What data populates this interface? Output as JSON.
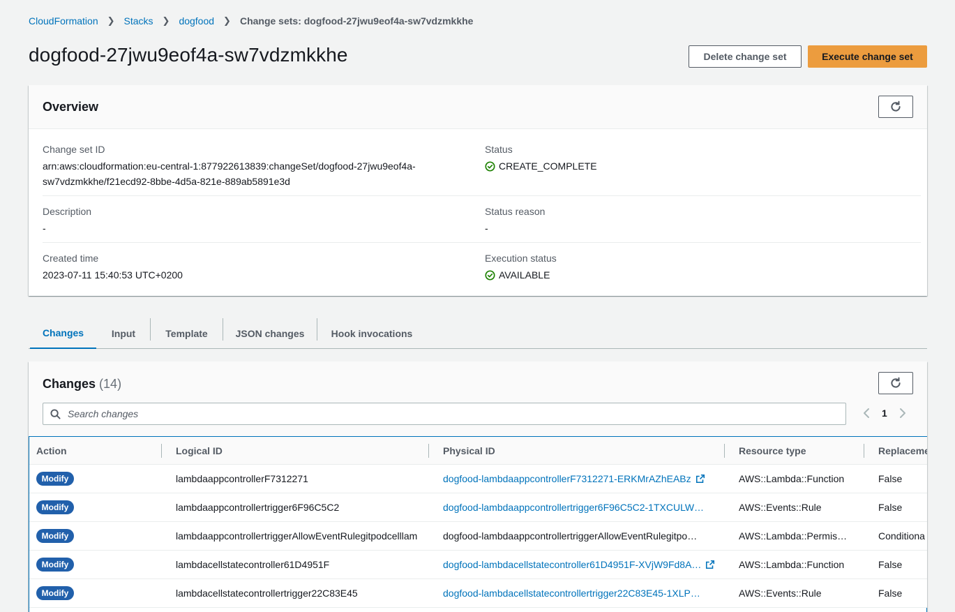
{
  "breadcrumb": {
    "items": [
      "CloudFormation",
      "Stacks",
      "dogfood"
    ],
    "current": "Change sets: dogfood-27jwu9eof4a-sw7vdzmkkhe"
  },
  "page": {
    "title": "dogfood-27jwu9eof4a-sw7vdzmkkhe",
    "delete_label": "Delete change set",
    "execute_label": "Execute change set"
  },
  "overview": {
    "title": "Overview",
    "changeset_id_label": "Change set ID",
    "changeset_id_line1": "arn:aws:cloudformation:eu-central-1:877922613839:changeSet/dogfood-27jwu9eof4a-",
    "changeset_id_line2": "sw7vdzmkkhe/f21ecd92-8bbe-4d5a-821e-889ab5891e3d",
    "status_label": "Status",
    "status_value": "CREATE_COMPLETE",
    "description_label": "Description",
    "description_value": "-",
    "status_reason_label": "Status reason",
    "status_reason_value": "-",
    "created_label": "Created time",
    "created_value": "2023-07-11 15:40:53 UTC+0200",
    "execution_label": "Execution status",
    "execution_value": "AVAILABLE"
  },
  "tabs": [
    "Changes",
    "Input",
    "Template",
    "JSON changes",
    "Hook invocations"
  ],
  "changes": {
    "title": "Changes",
    "count": "(14)",
    "search_placeholder": "Search changes",
    "page": "1",
    "columns": [
      "Action",
      "Logical ID",
      "Physical ID",
      "Resource type",
      "Replaceme"
    ],
    "rows": [
      {
        "action": "Modify",
        "logical": "lambdaappcontrollerF7312271",
        "physical": "dogfood-lambdaappcontrollerF7312271-ERKMrAZhEABz",
        "physical_link": true,
        "external": true,
        "type": "AWS::Lambda::Function",
        "replacement": "False"
      },
      {
        "action": "Modify",
        "logical": "lambdaappcontrollertrigger6F96C5C2",
        "physical": "dogfood-lambdaappcontrollertrigger6F96C5C2-1TXCULW…",
        "physical_link": true,
        "external": false,
        "type": "AWS::Events::Rule",
        "replacement": "False"
      },
      {
        "action": "Modify",
        "logical": "lambdaappcontrollertriggerAllowEventRulegitpodcelllam",
        "physical": "dogfood-lambdaappcontrollertriggerAllowEventRulegitpo…",
        "physical_link": false,
        "external": false,
        "type": "AWS::Lambda::Permiss…",
        "replacement": "Conditiona"
      },
      {
        "action": "Modify",
        "logical": "lambdacellstatecontroller61D4951F",
        "physical": "dogfood-lambdacellstatecontroller61D4951F-XVjW9Fd8A…",
        "physical_link": true,
        "external": true,
        "type": "AWS::Lambda::Function",
        "replacement": "False"
      },
      {
        "action": "Modify",
        "logical": "lambdacellstatecontrollertrigger22C83E45",
        "physical": "dogfood-lambdacellstatecontrollertrigger22C83E45-1XLP…",
        "physical_link": true,
        "external": false,
        "type": "AWS::Events::Rule",
        "replacement": "False"
      }
    ]
  }
}
